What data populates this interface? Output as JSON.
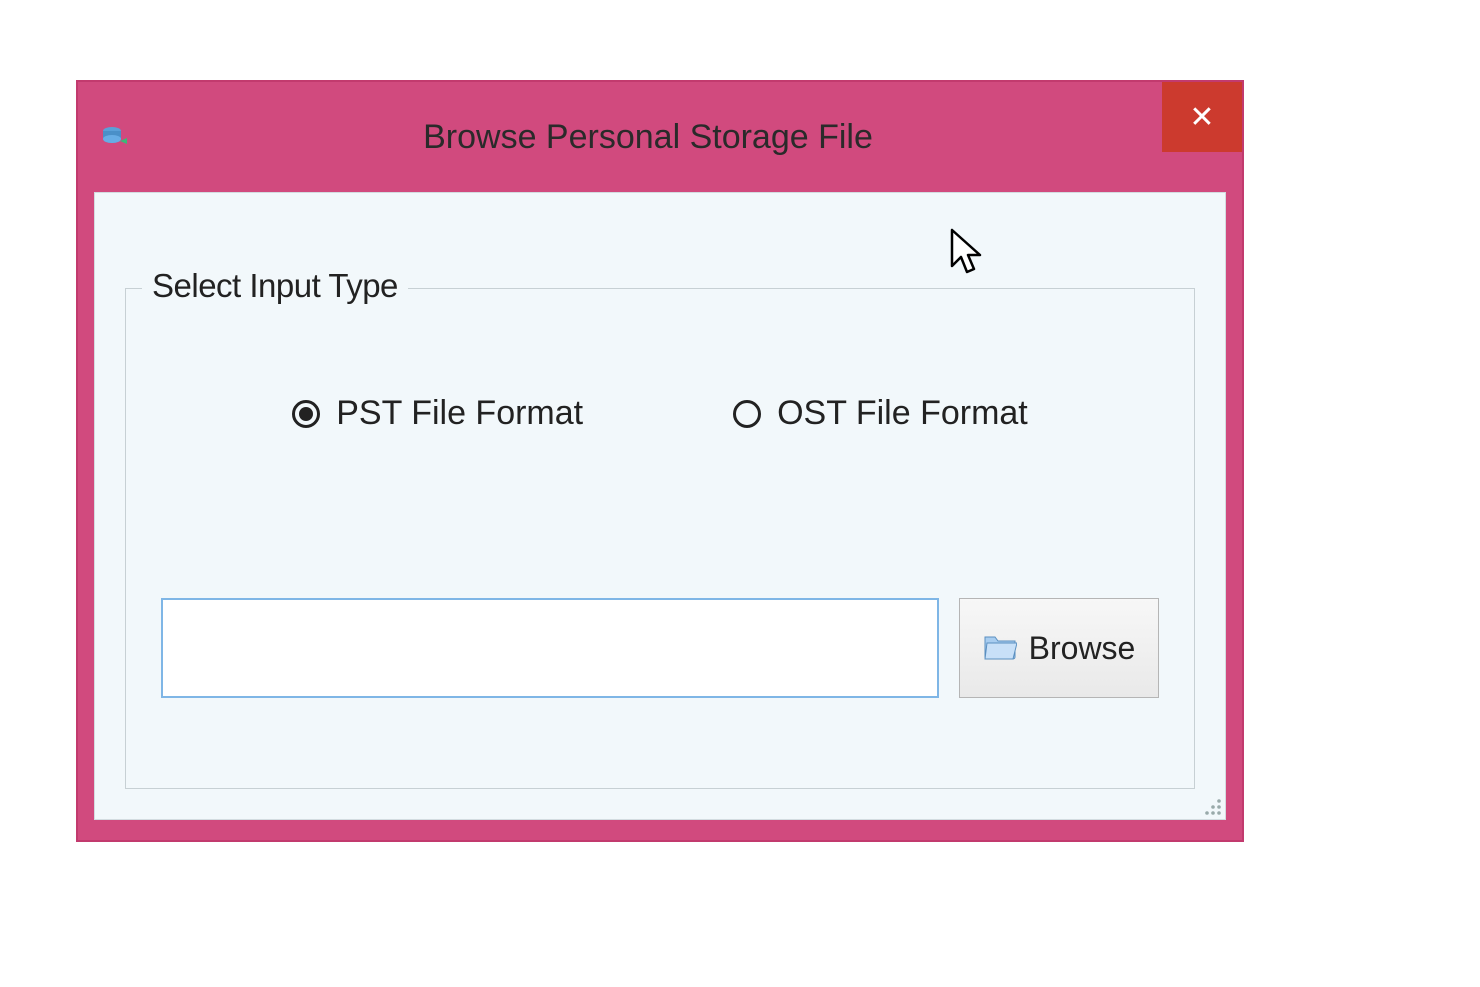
{
  "titlebar": {
    "title": "Browse Personal Storage File",
    "close_label": "✕",
    "icon_name": "app-icon"
  },
  "groupbox": {
    "label": "Select Input Type",
    "options": [
      {
        "label": "PST File Format",
        "selected": true
      },
      {
        "label": "OST File Format",
        "selected": false
      }
    ]
  },
  "path": {
    "value": ""
  },
  "browse": {
    "label": "Browse",
    "icon_name": "folder-icon"
  }
}
